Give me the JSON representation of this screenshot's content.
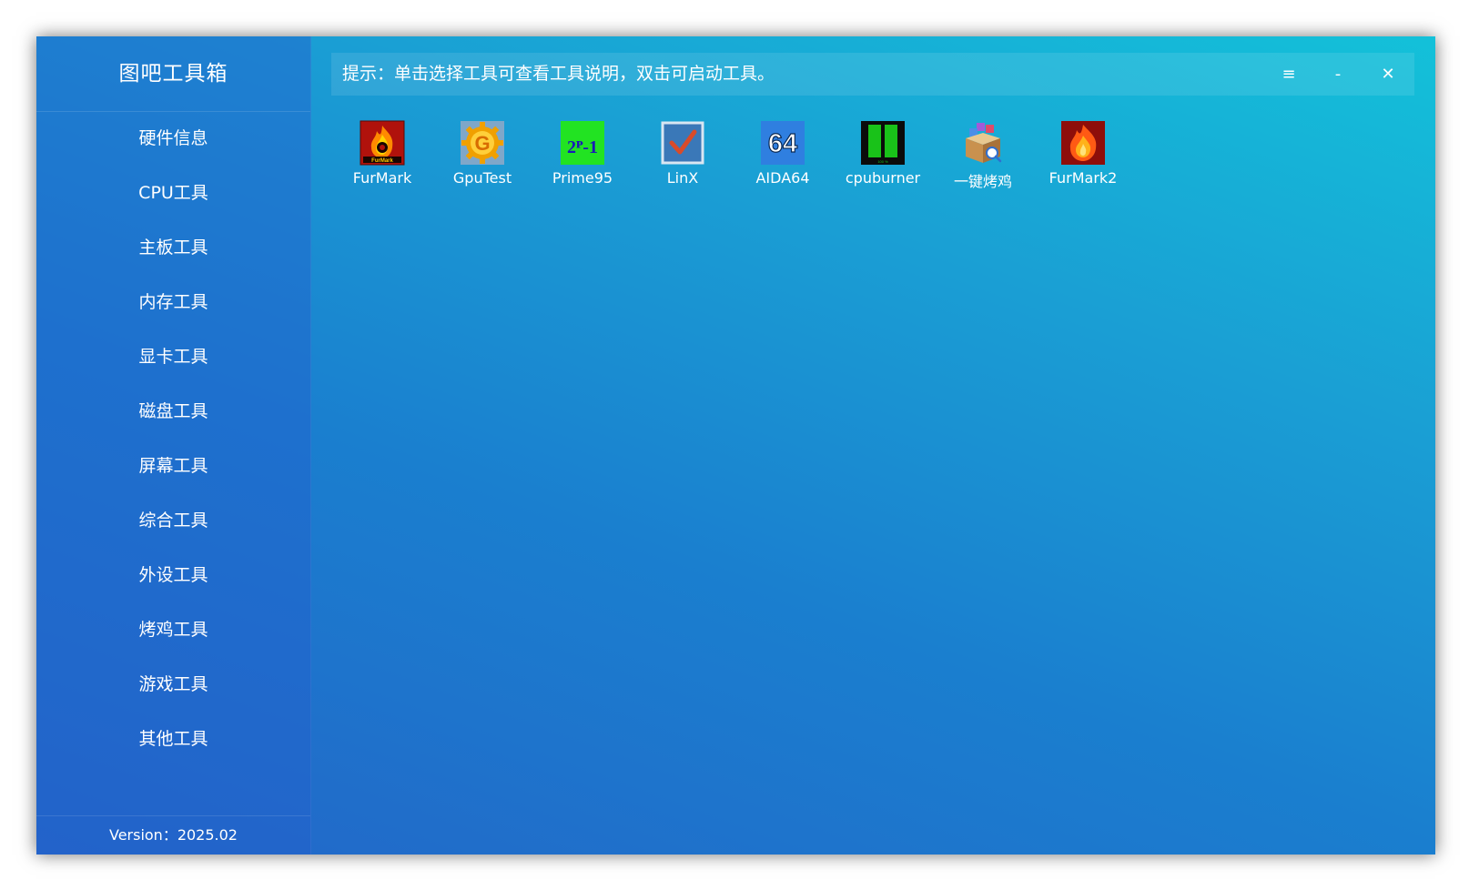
{
  "app": {
    "title": "图吧工具箱",
    "version": "Version：2025.02"
  },
  "sidebar": {
    "items": [
      {
        "label": "硬件信息"
      },
      {
        "label": "CPU工具"
      },
      {
        "label": "主板工具"
      },
      {
        "label": "内存工具"
      },
      {
        "label": "显卡工具"
      },
      {
        "label": "磁盘工具"
      },
      {
        "label": "屏幕工具"
      },
      {
        "label": "综合工具"
      },
      {
        "label": "外设工具"
      },
      {
        "label": "烤鸡工具"
      },
      {
        "label": "游戏工具"
      },
      {
        "label": "其他工具"
      }
    ]
  },
  "header": {
    "hint": "提示：单击选择工具可查看工具说明，双击可启动工具。",
    "menu_glyph": "≡",
    "minimize_glyph": "-",
    "close_glyph": "✕"
  },
  "tools": [
    {
      "label": "FurMark",
      "icon": "furmark-icon",
      "icon_text": "FurMark"
    },
    {
      "label": "GpuTest",
      "icon": "gputest-icon",
      "icon_text": "G"
    },
    {
      "label": "Prime95",
      "icon": "prime95-icon",
      "icon_text": "2ᴾ-1"
    },
    {
      "label": "LinX",
      "icon": "linx-icon",
      "icon_text": "✓"
    },
    {
      "label": "AIDA64",
      "icon": "aida64-icon",
      "icon_text": "64"
    },
    {
      "label": "cpuburner",
      "icon": "cpuburner-icon",
      "icon_text": "100 %"
    },
    {
      "label": "一键烤鸡",
      "icon": "package-icon",
      "icon_text": ""
    },
    {
      "label": "FurMark2",
      "icon": "furmark2-icon",
      "icon_text": ""
    }
  ],
  "colors": {
    "gradient_start": "#13c1d9",
    "gradient_end": "#2366c8",
    "text": "#ffffff"
  }
}
